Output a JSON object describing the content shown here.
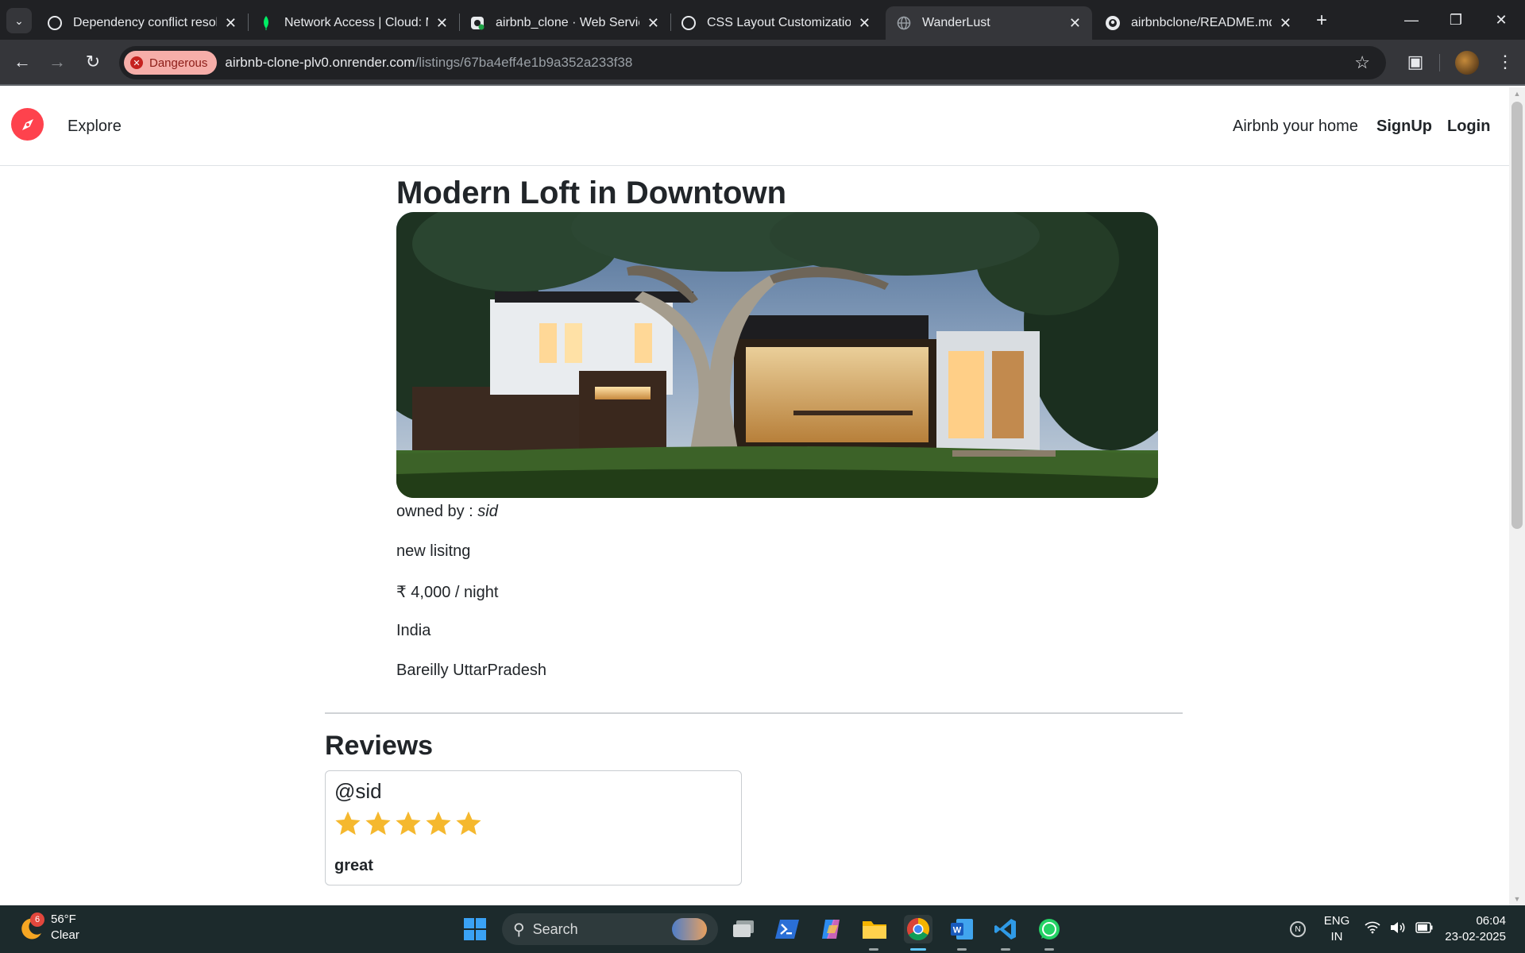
{
  "browser": {
    "tabs": [
      {
        "title": "Dependency conflict resolu",
        "icon": "openai-icon",
        "active": false
      },
      {
        "title": "Network Access | Cloud: M",
        "icon": "mongodb-leaf-icon",
        "active": false
      },
      {
        "title": "airbnb_clone · Web Service",
        "icon": "render-icon",
        "active": false
      },
      {
        "title": "CSS Layout Customization",
        "icon": "openai-icon",
        "active": false
      },
      {
        "title": "WanderLust",
        "icon": "globe-icon",
        "active": true
      },
      {
        "title": "airbnbclone/README.md a",
        "icon": "github-icon",
        "active": false
      }
    ],
    "security_chip": "Dangerous",
    "url_host": "airbnb-clone-plv0.onrender.com",
    "url_path": "/listings/67ba4eff4e1b9a352a233f38"
  },
  "site": {
    "nav": {
      "explore": "Explore",
      "airbnb_home": "Airbnb your home",
      "signup": "SignUp",
      "login": "Login"
    },
    "listing": {
      "title": "Modern Loft in Downtown",
      "owned_by_label": "owned by : ",
      "owner": "sid",
      "description": "new lisitng",
      "price": "₹ 4,000 / night",
      "country": "India",
      "location": "Bareilly UttarPradesh"
    },
    "reviews": {
      "heading": "Reviews",
      "items": [
        {
          "author": "@sid",
          "rating": 5,
          "comment": "great"
        }
      ]
    }
  },
  "taskbar": {
    "weather_badge": "6",
    "temperature": "56°F",
    "condition": "Clear",
    "search_placeholder": "Search",
    "language_line1": "ENG",
    "language_line2": "IN",
    "time": "06:04",
    "date": "23-02-2025"
  },
  "colors": {
    "brand": "#fe424d",
    "star": "#f5b82e",
    "danger_chip": "#f6aea9"
  }
}
